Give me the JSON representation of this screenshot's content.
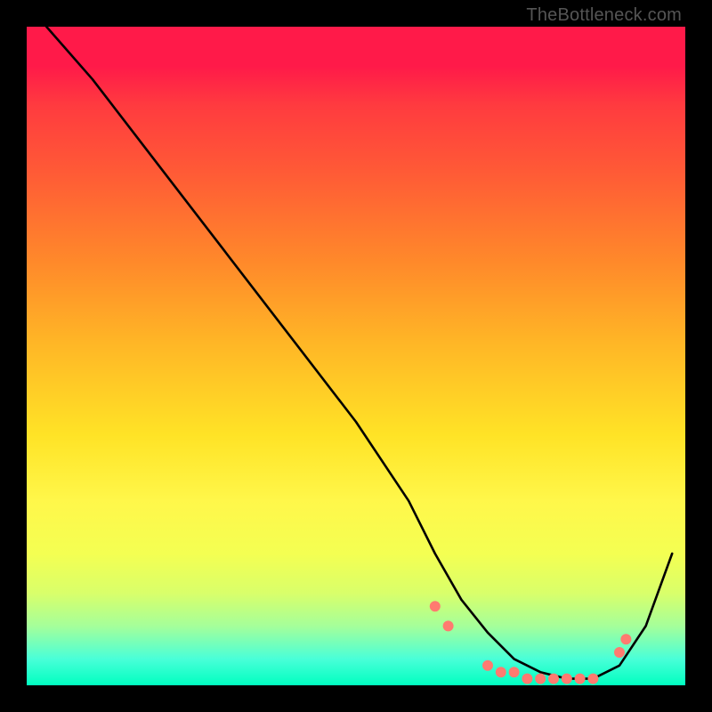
{
  "watermark": "TheBottleneck.com",
  "chart_data": {
    "type": "line",
    "title": "",
    "xlabel": "",
    "ylabel": "",
    "xlim": [
      0,
      100
    ],
    "ylim": [
      0,
      100
    ],
    "grid": false,
    "legend": false,
    "series": [
      {
        "name": "curve",
        "color": "#000000",
        "x": [
          3,
          10,
          20,
          30,
          40,
          50,
          58,
          62,
          66,
          70,
          74,
          78,
          82,
          86,
          90,
          94,
          98
        ],
        "y": [
          100,
          92,
          79,
          66,
          53,
          40,
          28,
          20,
          13,
          8,
          4,
          2,
          1,
          1,
          3,
          9,
          20
        ]
      }
    ],
    "markers": {
      "color": "#ff7a70",
      "radius_px": 6,
      "points": [
        {
          "x": 62,
          "y": 12
        },
        {
          "x": 64,
          "y": 9
        },
        {
          "x": 70,
          "y": 3
        },
        {
          "x": 72,
          "y": 2
        },
        {
          "x": 74,
          "y": 2
        },
        {
          "x": 76,
          "y": 1
        },
        {
          "x": 78,
          "y": 1
        },
        {
          "x": 80,
          "y": 1
        },
        {
          "x": 82,
          "y": 1
        },
        {
          "x": 84,
          "y": 1
        },
        {
          "x": 86,
          "y": 1
        },
        {
          "x": 90,
          "y": 5
        },
        {
          "x": 91,
          "y": 7
        }
      ]
    },
    "optimal_band": {
      "y_from": 0,
      "y_to": 6
    }
  }
}
